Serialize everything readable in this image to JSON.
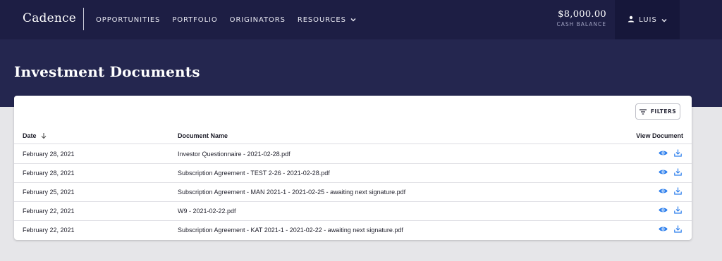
{
  "nav": {
    "logo": "Cadence",
    "links": [
      "OPPORTUNITIES",
      "PORTFOLIO",
      "ORIGINATORS",
      "RESOURCES"
    ],
    "balance_amount": "$8,000.00",
    "balance_label": "CASH BALANCE",
    "user": "LUIS"
  },
  "page": {
    "title": "Investment Documents"
  },
  "table": {
    "filters_label": "FILTERS",
    "columns": {
      "date": "Date",
      "document": "Document Name",
      "view": "View Document"
    },
    "rows": [
      {
        "date": "February 28, 2021",
        "document": "Investor Questionnaire - 2021-02-28.pdf"
      },
      {
        "date": "February 28, 2021",
        "document": "Subscription Agreement - TEST 2-26 - 2021-02-28.pdf"
      },
      {
        "date": "February 25, 2021",
        "document": "Subscription Agreement - MAN 2021-1 - 2021-02-25 - awaiting next signature.pdf"
      },
      {
        "date": "February 22, 2021",
        "document": "W9 - 2021-02-22.pdf"
      },
      {
        "date": "February 22, 2021",
        "document": "Subscription Agreement - KAT 2021-1 - 2021-02-22 - awaiting next signature.pdf"
      }
    ]
  },
  "icons": {
    "view": "eye-icon",
    "download": "download-icon",
    "sort": "arrow-down-icon",
    "filter": "filter-icon",
    "user": "user-icon"
  },
  "colors": {
    "nav_bg": "#1d1e44",
    "hero_bg": "#24264f",
    "accent": "#2f80ed",
    "page_bg": "#e6e6e9"
  }
}
